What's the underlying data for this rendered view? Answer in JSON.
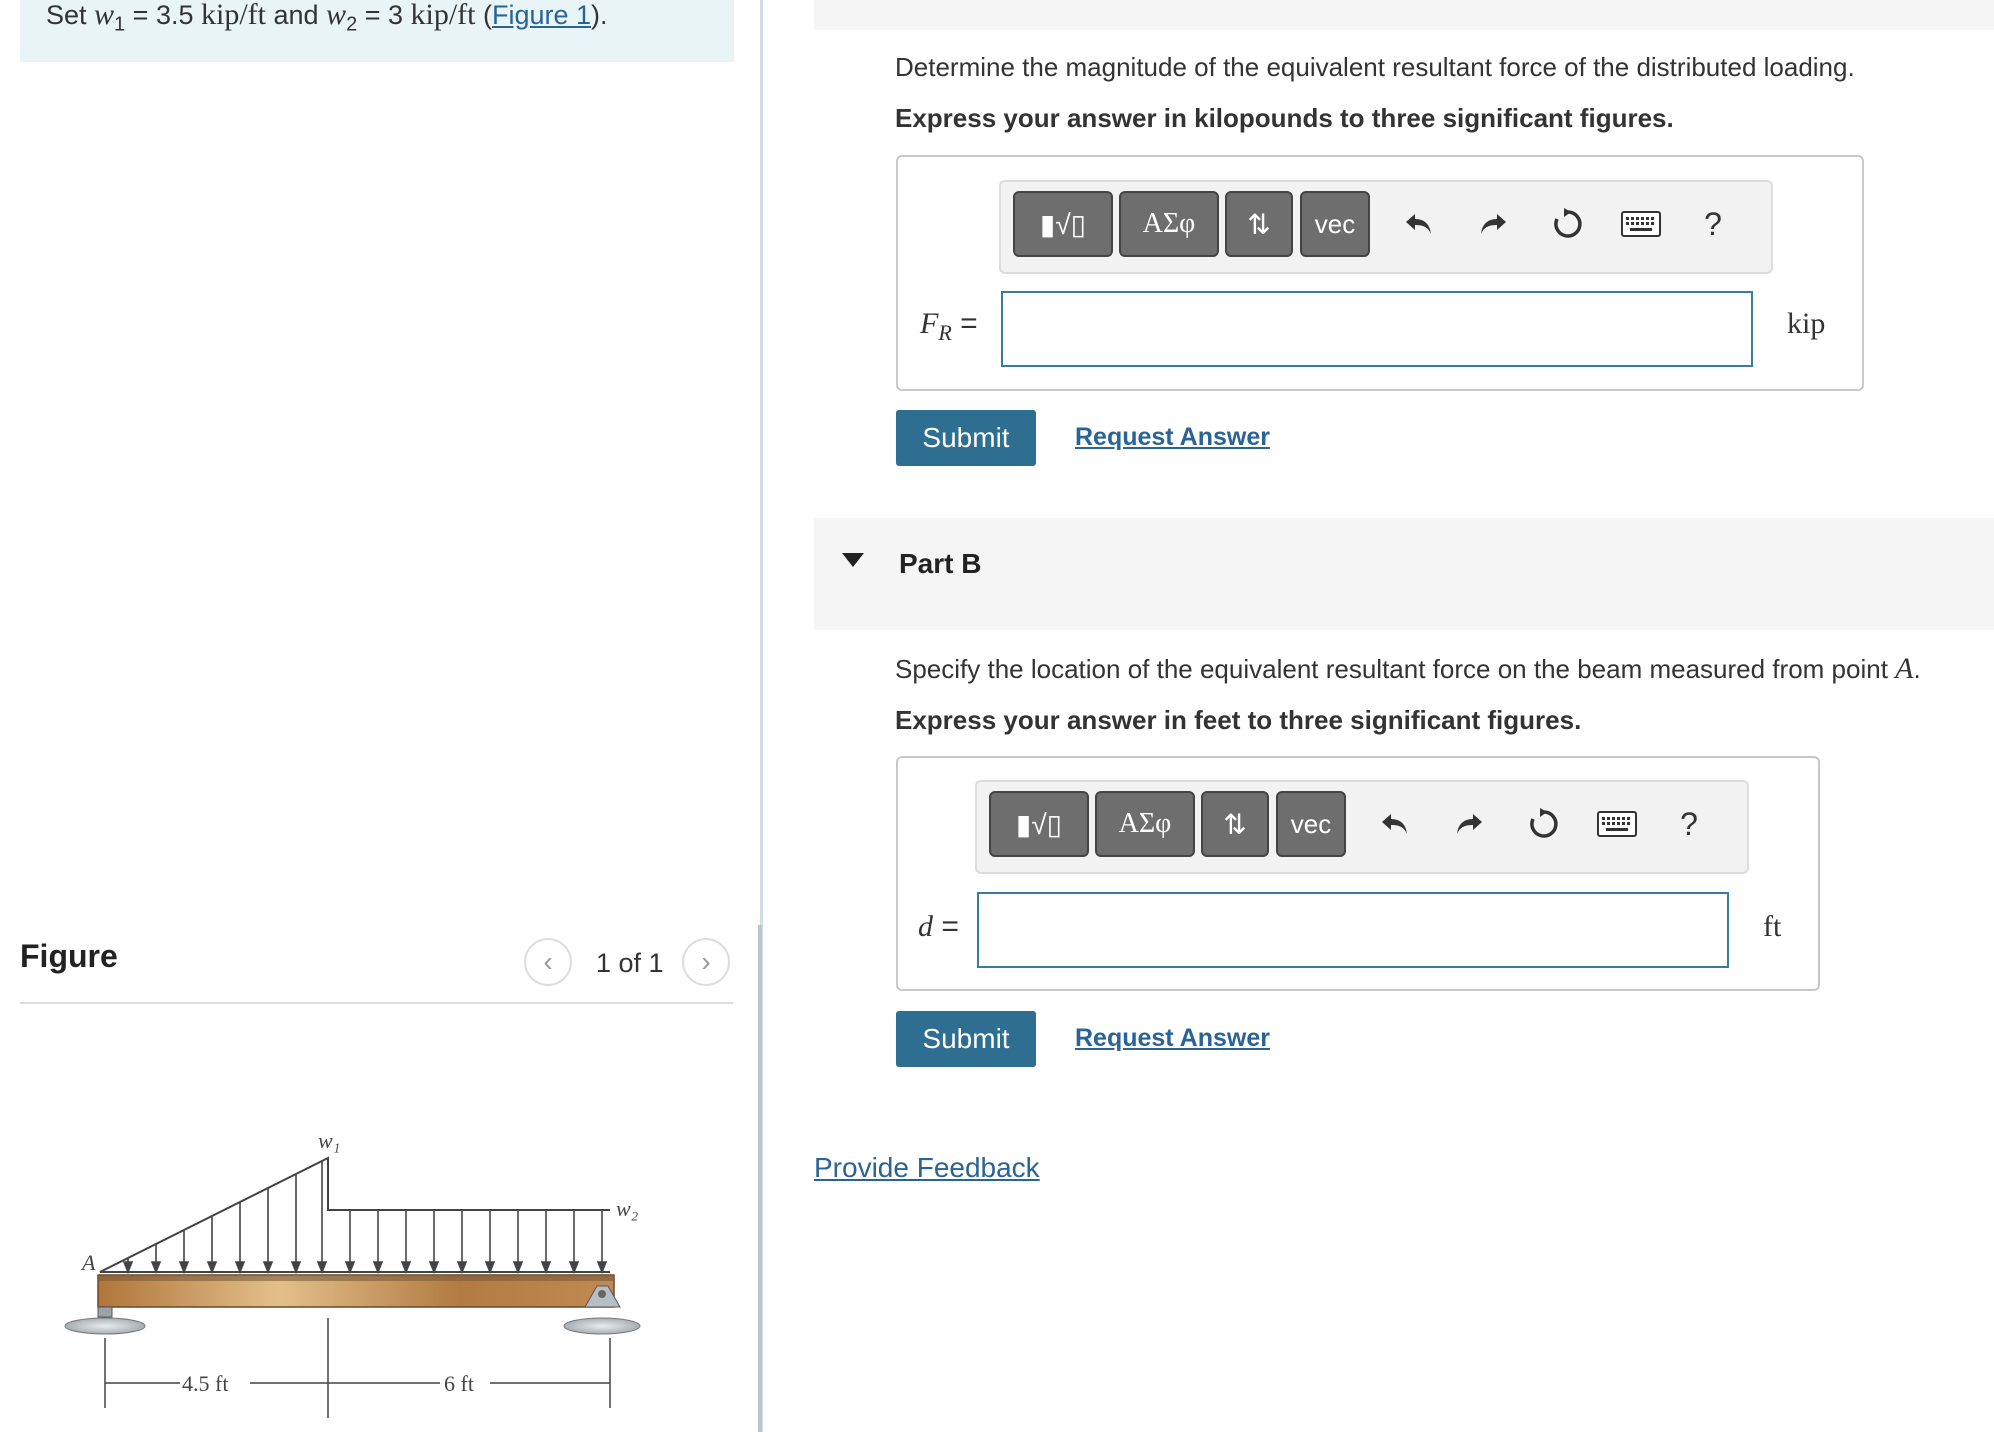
{
  "problem": {
    "prefix": "Set ",
    "w1_sym": "w",
    "w1_sub": "1",
    "eq1": " = 3.5 ",
    "unit1": "kip/ft",
    "and": " and ",
    "w2_sym": "w",
    "w2_sub": "2",
    "eq2": " = 3 ",
    "unit2": "kip/ft",
    "open": " (",
    "figure_link": "Figure 1",
    "close": ")."
  },
  "figure_panel": {
    "title": "Figure",
    "pager_text": "1 of 1",
    "prev_icon": "chevron-left-icon",
    "next_icon": "chevron-right-icon",
    "labels": {
      "w1": "w₁",
      "w2": "w₂",
      "A": "A",
      "dim1": "4.5 ft",
      "dim2": "6 ft"
    }
  },
  "part_a": {
    "question": "Determine the magnitude of the equivalent resultant force of the distributed loading.",
    "instruction": "Express your answer in kilopounds to three significant figures.",
    "label_main": "F",
    "label_sub": "R",
    "label_eq": " =",
    "input_value": "",
    "unit": "kip",
    "submit": "Submit",
    "request": "Request Answer"
  },
  "part_b": {
    "title": "Part B",
    "question_prefix": "Specify the location of the equivalent resultant force on the beam measured from point ",
    "question_point": "A",
    "question_suffix": ".",
    "instruction": "Express your answer in feet to three significant figures.",
    "label_main": "d",
    "label_eq": " =",
    "input_value": "",
    "unit": "ft",
    "submit": "Submit",
    "request": "Request Answer"
  },
  "toolbar": {
    "templates": "▮√▯",
    "greek": "ΑΣφ",
    "updown": "⇅",
    "vec": "vec",
    "help": "?",
    "icons": [
      "templates-icon",
      "greek-letters-icon",
      "sort-arrows-icon",
      "vec-icon",
      "undo-icon",
      "redo-icon",
      "reset-icon",
      "keyboard-icon",
      "help-icon"
    ]
  },
  "feedback": "Provide Feedback",
  "colors": {
    "accent": "#2e6e91",
    "link": "#2a6496",
    "problem_bg": "#e8f4f6",
    "button_dark": "#6e6e6e"
  }
}
